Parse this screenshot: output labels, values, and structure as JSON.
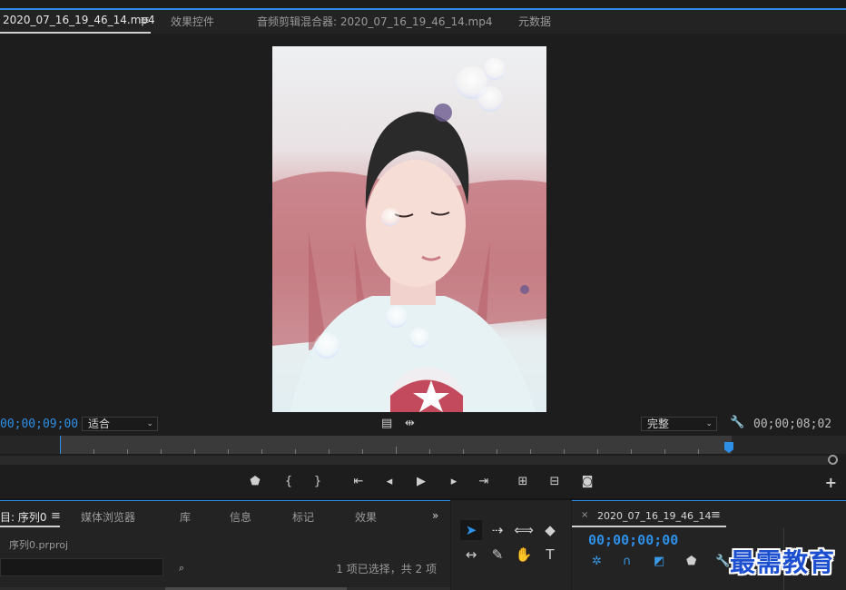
{
  "tabs": [
    {
      "label": "2020_07_16_19_46_14.mp4",
      "active": true
    },
    {
      "label": "效果控件",
      "active": false
    },
    {
      "label": "音频剪辑混合器: 2020_07_16_19_46_14.mp4",
      "active": false
    },
    {
      "label": "元数据",
      "active": false
    }
  ],
  "monitor": {
    "timecode_left": "00;00;09;00",
    "fit_select": "适合",
    "quality_select": "完整",
    "timecode_right": "00;00;08;02",
    "accent_color": "#2e8fe6"
  },
  "project_panel": {
    "tabs": [
      {
        "label": "目: 序列0",
        "active": true
      },
      {
        "label": "媒体浏览器",
        "active": false
      },
      {
        "label": "库",
        "active": false
      },
      {
        "label": "信息",
        "active": false
      },
      {
        "label": "标记",
        "active": false
      },
      {
        "label": "效果",
        "active": false
      }
    ],
    "overflow": "»",
    "file_name": "序列0.prproj",
    "selection_status": "1 项已选择，共 2 项"
  },
  "timeline": {
    "sequence_name": "2020_07_16_19_46_14",
    "timecode": "00;00;00;00"
  },
  "watermark": "最需教育"
}
